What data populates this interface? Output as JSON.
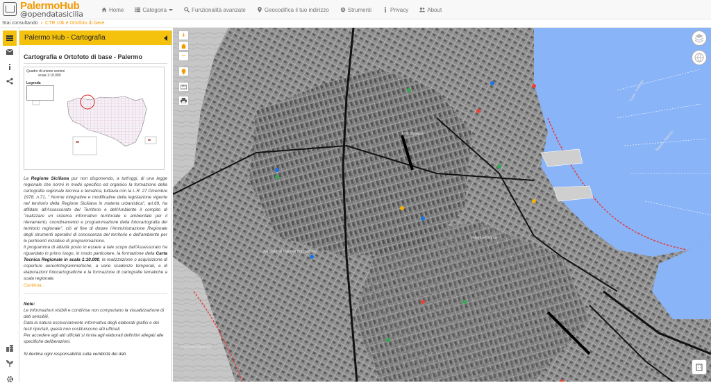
{
  "logo": {
    "title": "PalermoHub",
    "subtitle": "@opendatasicilia"
  },
  "nav": [
    {
      "label": "Home",
      "icon": "home-icon"
    },
    {
      "label": "Categoria",
      "icon": "list-icon",
      "dropdown": true
    },
    {
      "label": "Funzionalità avanzate",
      "icon": "search-icon"
    },
    {
      "label": "Geocodifica il tuo indirizzo",
      "icon": "map-marker-icon"
    },
    {
      "label": "Strumenti",
      "icon": "gear-icon"
    },
    {
      "label": "Privacy",
      "icon": "info-icon"
    },
    {
      "label": "About",
      "icon": "users-icon"
    }
  ],
  "breadcrumb": {
    "prefix": "Stai consultando",
    "current": "CTR 10k e Ortofoto di base"
  },
  "panel": {
    "header": "Palermo Hub - Cartografia",
    "title": "Cartografia e Ortofoto di base - Palermo",
    "thumbnail": {
      "caption1": "Quadro di unione sezioni",
      "caption2": "scala 1:10.000",
      "legend_title": "Legenda"
    },
    "intro": {
      "p1_a": "La ",
      "p1_b": "Regione Siciliana",
      "p1_c": " pur non disponendo, a tutt'oggi, di una legge regionale che normi in modo specifico ed organico la formazione della cartografia regionale tecnica e tematica, tuttavia con la L.R. 27 Dicembre 1978, n.71, \" Norme integrative e modificative della legislazione vigente nel territorio della Regione Siciliana in materia urbanistica\", art.69, ha affidato all'Assessorato del Territorio e dell'Ambiente il compito di \"realizzare un sistema informativo territoriale e ambientale per il rilevamento, coordinamento e programmazione della fotocartografia del territorio regionale\", ciò al fine di dotare l'Amministrazione Regionale degli strumenti operativi di conoscenza del territorio e dell'ambiente per le pertinenti iniziative di programmazione.",
      "p2_a": "Il programma di attività posto in essere a tale scopo dall'Assessorato ha riguardato in primo luogo, in modo particolare, la formazione della ",
      "p2_b": "Carta Tecnica Regionale in scala 1:10.000",
      "p2_c": ", la realizzazione o acquisizione di coperture aereofotogrammetriche, a varie scadenze temporali, e di elaborazioni fotocartografiche e la formazione di cartografie tematiche a scala regionale.",
      "continue": "Continua..."
    },
    "note": {
      "label": "Note:",
      "l1": "Le informazioni visibili e condivise non comportano la visualizzazione di dati sensibili.",
      "l2": "Data la natura esclusivamente informativa degli elaborati grafici e dei testi riportati, questi non costituiscono atti ufficiali.",
      "l3": "Per accedere agli atti ufficiali si rinvia agli elaborati definitivi allegati alle specifiche deliberazioni."
    },
    "disclaimer": "Si declina ogni responsabilità sulla veridicità dei dati."
  },
  "map": {
    "labels": [
      "Orto Botanico",
      "Napoli - Palermo",
      "Tunisi - Palermo",
      "Ospedale Ingrassia",
      "Aeroporto di Palermo Boccadifalco",
      "Palermo Centrale"
    ]
  },
  "colors": {
    "accent": "#f4c20d",
    "brand": "#f29900",
    "sea": "#8ab4f8",
    "map_land": "#9a9a9a"
  }
}
